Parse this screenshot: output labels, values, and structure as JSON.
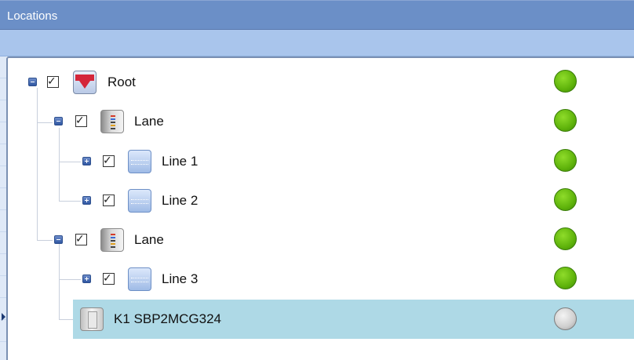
{
  "window": {
    "title": "Locations"
  },
  "tree": {
    "nodes": [
      {
        "label": "Root",
        "icon": "company-logo-icon",
        "expander": "collapse",
        "checked": true,
        "status": "online",
        "status_color": "#5fb30b"
      },
      {
        "label": "Lane",
        "icon": "lane-module-icon",
        "expander": "collapse",
        "checked": true,
        "status": "online",
        "status_color": "#5fb30b"
      },
      {
        "label": "Line 1",
        "icon": "bus-line-icon",
        "expander": "expand",
        "checked": true,
        "status": "online",
        "status_color": "#5fb30b"
      },
      {
        "label": "Line 2",
        "icon": "bus-line-icon",
        "expander": "expand",
        "checked": true,
        "status": "online",
        "status_color": "#5fb30b"
      },
      {
        "label": "Lane",
        "icon": "lane-module-icon",
        "expander": "collapse",
        "checked": true,
        "status": "online",
        "status_color": "#5fb30b"
      },
      {
        "label": "Line 3",
        "icon": "bus-line-icon",
        "expander": "expand",
        "checked": true,
        "status": "online",
        "status_color": "#5fb30b"
      },
      {
        "label": "K1 SBP2MCG324",
        "icon": "device-module-icon",
        "expander": "none",
        "checked": false,
        "status": "offline",
        "status_color": "#cfcfcf",
        "selected": true
      }
    ]
  },
  "glyphs": {
    "check": "✓"
  },
  "colors": {
    "titlebar": "#6b8fc7",
    "toolbar": "#a9c5ec",
    "selection": "#aed9e6"
  }
}
